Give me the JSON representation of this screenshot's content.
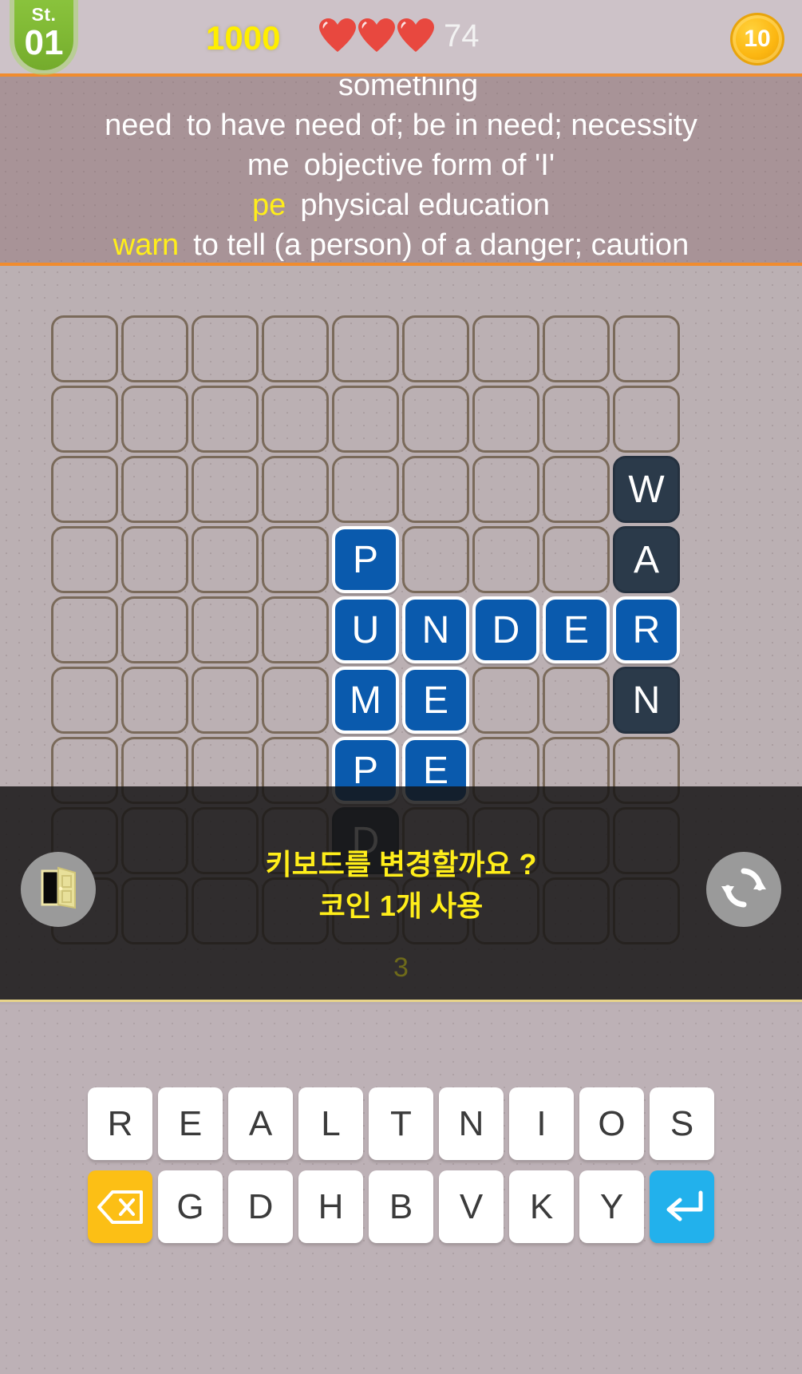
{
  "topbar": {
    "stage_label": "St.",
    "stage_number": "01",
    "score": "1000",
    "lives_icons": [
      "heart-icon",
      "heart-icon",
      "heart-icon"
    ],
    "lives_count": "74",
    "coin_count": "10",
    "accent_color": "#f08c2e",
    "score_color": "#ffee00",
    "stage_color": "#8dc63f",
    "coin_color": "#fcb712"
  },
  "clues": {
    "lines": [
      {
        "word": "",
        "definition": "something",
        "found": false,
        "partial": true
      },
      {
        "word": "need",
        "definition": "to have need of; be in need; necessity",
        "found": false
      },
      {
        "word": "me",
        "definition": "objective form of 'I'",
        "found": false
      },
      {
        "word": "pe",
        "definition": "physical education",
        "found": true
      },
      {
        "word": "warn",
        "definition": "to tell (a person) of a danger; caution",
        "found": true
      }
    ]
  },
  "board": {
    "rows": 9,
    "cols": 9,
    "tile_blue": "#0a5aad",
    "tile_dark": "#2b3a4a",
    "cells": [
      [
        "",
        "",
        "",
        "",
        "",
        "",
        "",
        "",
        ""
      ],
      [
        "",
        "",
        "",
        "",
        "",
        "",
        "",
        "",
        ""
      ],
      [
        "",
        "",
        "",
        "",
        "",
        "",
        "",
        "",
        "W"
      ],
      [
        "",
        "",
        "",
        "",
        "P",
        "",
        "",
        "",
        "A"
      ],
      [
        "",
        "",
        "",
        "",
        "U",
        "N",
        "D",
        "E",
        "R"
      ],
      [
        "",
        "",
        "",
        "",
        "M",
        "E",
        "",
        "",
        "N"
      ],
      [
        "",
        "",
        "",
        "",
        "P",
        "E",
        "",
        "",
        ""
      ],
      [
        "",
        "",
        "",
        "",
        "D",
        "",
        "",
        "",
        ""
      ],
      [
        "",
        "",
        "",
        "",
        "",
        "",
        "",
        "",
        ""
      ]
    ],
    "states": [
      [
        "empty",
        "empty",
        "empty",
        "empty",
        "empty",
        "empty",
        "empty",
        "empty",
        "empty"
      ],
      [
        "empty",
        "empty",
        "empty",
        "empty",
        "empty",
        "empty",
        "empty",
        "empty",
        "empty"
      ],
      [
        "empty",
        "empty",
        "empty",
        "empty",
        "empty",
        "empty",
        "empty",
        "empty",
        "dark"
      ],
      [
        "empty",
        "empty",
        "empty",
        "empty",
        "filled",
        "empty",
        "empty",
        "empty",
        "dark"
      ],
      [
        "empty",
        "empty",
        "empty",
        "empty",
        "filled",
        "filled",
        "filled",
        "filled",
        "filled"
      ],
      [
        "empty",
        "empty",
        "empty",
        "empty",
        "filled",
        "filled",
        "empty",
        "empty",
        "dark"
      ],
      [
        "empty",
        "empty",
        "empty",
        "empty",
        "filled",
        "filled",
        "empty",
        "empty",
        "empty"
      ],
      [
        "empty",
        "empty",
        "empty",
        "empty",
        "dark",
        "empty",
        "empty",
        "empty",
        "empty"
      ],
      [
        "empty",
        "empty",
        "empty",
        "empty",
        "empty",
        "empty",
        "empty",
        "empty",
        "empty"
      ]
    ]
  },
  "overlay": {
    "message_line1": "키보드를 변경할까요 ?",
    "message_line2": "코인 1개 사용",
    "message_color": "#ffee1a",
    "exit_icon": "door-icon",
    "refresh_icon": "refresh-icon",
    "counter": "3"
  },
  "keyboard": {
    "row1": [
      "R",
      "E",
      "A",
      "L",
      "T",
      "N",
      "I",
      "O",
      "S"
    ],
    "row2_letters": [
      "G",
      "D",
      "H",
      "B",
      "V",
      "K",
      "Y"
    ],
    "backspace_icon": "backspace-icon",
    "enter_icon": "enter-icon",
    "backspace_color": "#fcbf15",
    "enter_color": "#22b1ec"
  }
}
